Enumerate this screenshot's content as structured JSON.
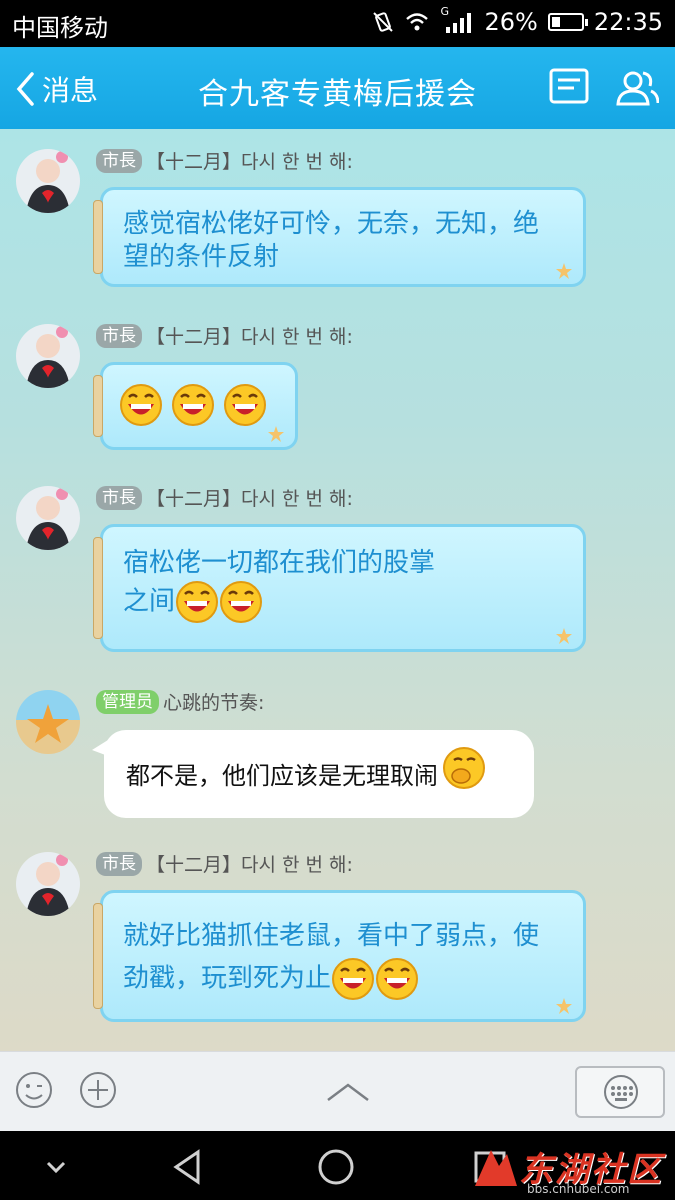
{
  "status_bar": {
    "carrier": "中国移动",
    "battery": "26%",
    "time": "22:35",
    "signal_type": "G"
  },
  "header": {
    "back_label": "消息",
    "title": "合九客专黄梅后援会"
  },
  "messages": [
    {
      "badge": "市長",
      "badge_color": "#9aa7a8",
      "sender": "【十二月】다시 한 번 해:",
      "text": "感觉宿松佬好可怜，无奈，无知，绝望的条件反射",
      "emoji_count": 0
    },
    {
      "badge": "市長",
      "badge_color": "#9aa7a8",
      "sender": "【十二月】다시 한 번 해:",
      "text": "",
      "emoji_count": 3
    },
    {
      "badge": "市長",
      "badge_color": "#9aa7a8",
      "sender": "【十二月】다시 한 번 해:",
      "text": "宿松佬一切都在我们的股掌之间",
      "emoji_count": 2
    },
    {
      "badge": "管理员",
      "badge_color": "#7fcf6a",
      "sender": "心跳的节奏:",
      "text": "都不是，他们应该是无理取闹",
      "emoji_count": 1
    },
    {
      "badge": "市長",
      "badge_color": "#9aa7a8",
      "sender": "【十二月】다시 한 번 해:",
      "text": "就好比猫抓住老鼠，看中了弱点，使劲戳，玩到死为止",
      "emoji_count": 2
    }
  ],
  "watermark": {
    "text": "东湖社区",
    "url": "bbs.cnhubei.com"
  },
  "colors": {
    "nav_bar": "#1aaae6",
    "bubble_text": "#1e8fd0",
    "jar_border": "#7fd3f0"
  }
}
